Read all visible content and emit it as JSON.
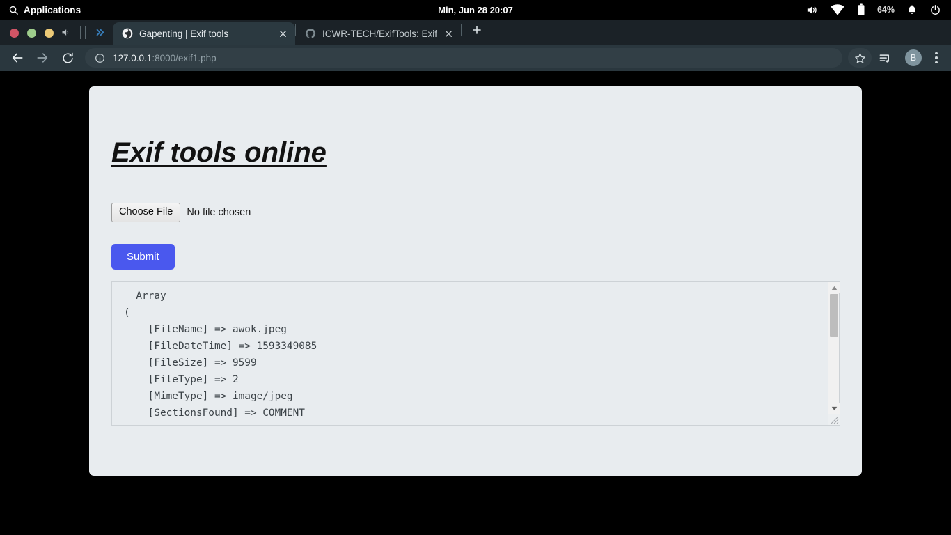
{
  "os_bar": {
    "search_icon": "search-icon",
    "applications_label": "Applications",
    "datetime": "Min, Jun 28    20:07",
    "volume_icon": "speaker-icon",
    "wifi_icon": "wifi-icon",
    "battery_icon": "battery-icon",
    "battery_percent": "64%",
    "notification_icon": "bell-icon",
    "power_icon": "power-icon"
  },
  "browser": {
    "window_controls": [
      "close",
      "minimize",
      "maximize"
    ],
    "mute_icon": "speaker-mute-icon",
    "sidebar_toggle_icon": "chevrons-right-icon",
    "tabs": [
      {
        "title": "Gapenting | Exif tools",
        "favicon": "globe-icon",
        "active": true,
        "close_label": "×"
      },
      {
        "title": "ICWR-TECH/ExifTools: Exif tools",
        "favicon": "github-icon",
        "active": false,
        "close_label": "×"
      }
    ],
    "new_tab_label": "+",
    "toolbar": {
      "back_icon": "arrow-left-icon",
      "forward_icon": "arrow-right-icon",
      "reload_icon": "reload-icon",
      "site_info_icon": "info-circle-icon",
      "url_host": "127.0.0.1",
      "url_rest": ":8000/exif1.php",
      "bookmark_icon": "star-icon",
      "media_icon": "media-playlist-icon",
      "profile_initial": "B",
      "menu_icon": "kebab-menu-icon"
    }
  },
  "page": {
    "heading": "Exif tools online",
    "file_input": {
      "button_label": "Choose File",
      "status_text": "No file chosen"
    },
    "submit_label": "Submit",
    "output": "  Array\n(\n    [FileName] => awok.jpeg\n    [FileDateTime] => 1593349085\n    [FileSize] => 9599\n    [FileType] => 2\n    [MimeType] => image/jpeg\n    [SectionsFound] => COMMENT\n    [COMPUTED] => Array",
    "output_scroll": {
      "up_arrow": "▲",
      "down_arrow": "▼"
    }
  },
  "colors": {
    "accent_button": "#4a58ee",
    "card_background": "#e8ecef",
    "browser_toolbar": "#2a373e",
    "tabstrip": "#1b2227",
    "active_tab": "#2b3940",
    "page_background": "#000000"
  }
}
